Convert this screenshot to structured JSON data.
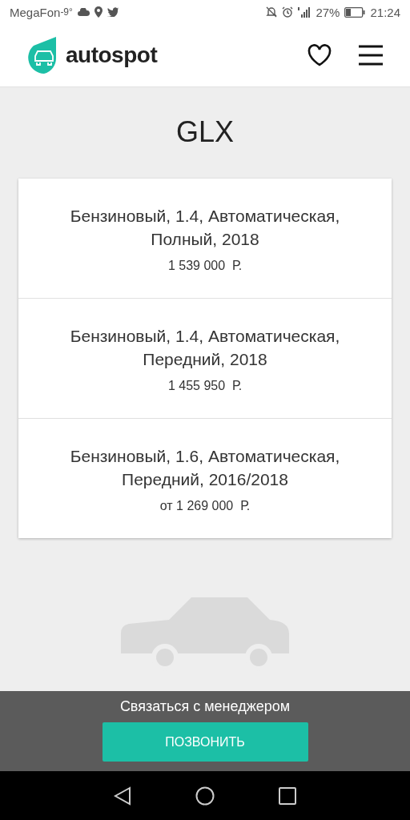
{
  "status_bar": {
    "carrier": "MegaFon",
    "temperature": "-9°",
    "battery": "27%",
    "time": "21:24"
  },
  "header": {
    "logo": "autospot"
  },
  "title": "GLX",
  "options": [
    {
      "description": "Бензиновый, 1.4, Автоматическая, Полный, 2018",
      "price": "1 539 000  Р."
    },
    {
      "description": "Бензиновый, 1.4, Автоматическая, Передний, 2018",
      "price": "1 455 950  Р."
    },
    {
      "description": "Бензиновый, 1.6, Автоматическая, Передний, 2016/2018",
      "price": "от 1 269 000  Р."
    }
  ],
  "contact_bar": {
    "label": "Связаться с менеджером",
    "button": "ПОЗВОНИТЬ"
  }
}
